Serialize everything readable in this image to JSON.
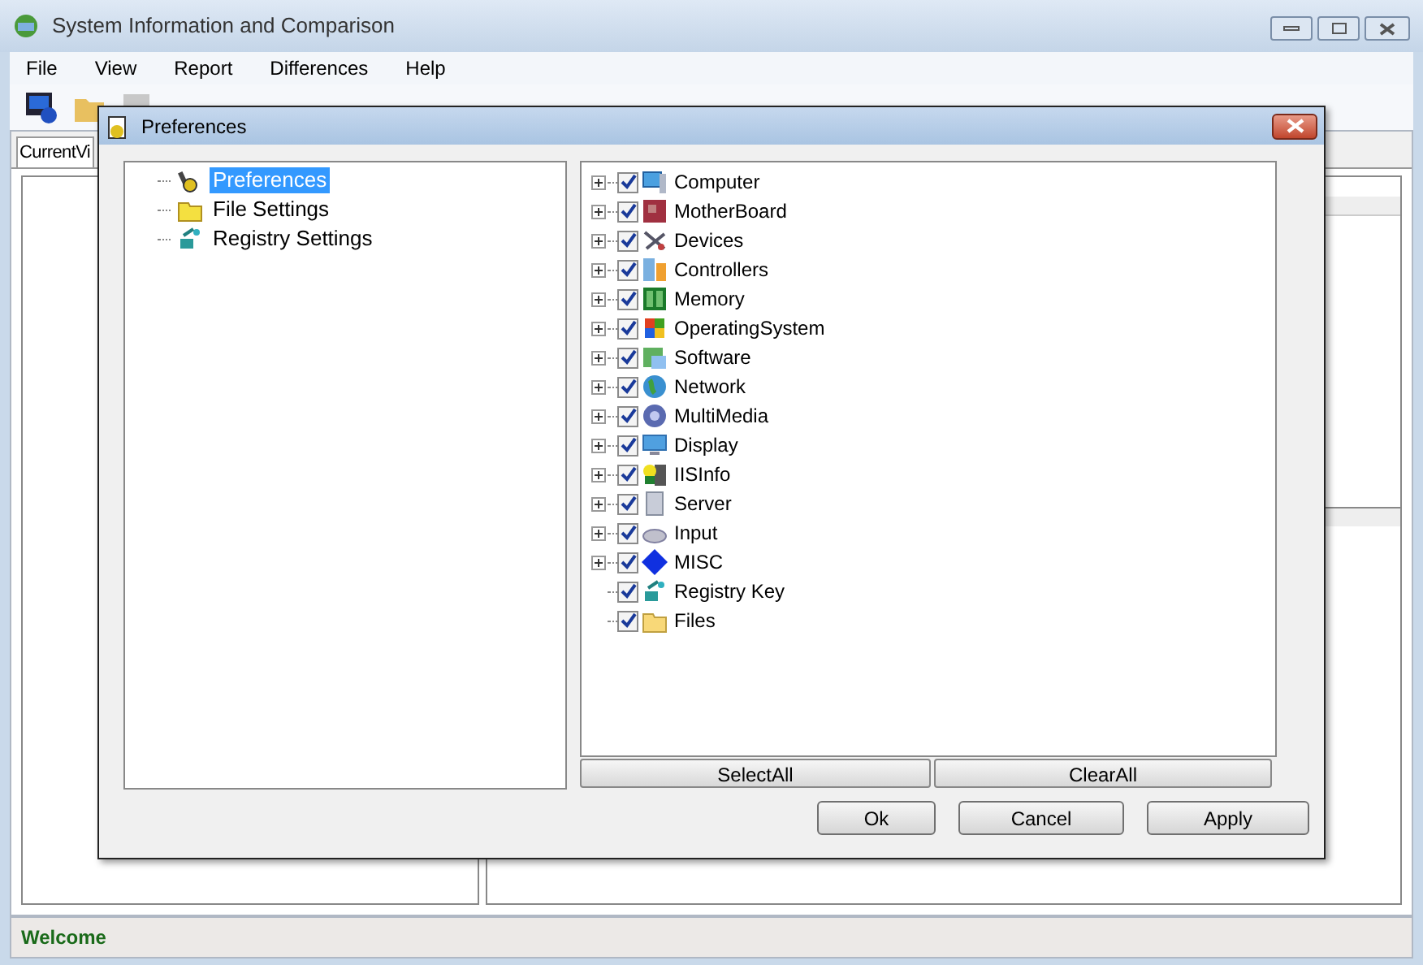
{
  "window": {
    "title": "System Information and Comparison"
  },
  "menu": [
    "File",
    "View",
    "Report",
    "Differences",
    "Help"
  ],
  "main_tab": {
    "label": "CurrentVi",
    "selected": true
  },
  "status_bar": "Welcome",
  "dialog": {
    "title": "Preferences",
    "nav": [
      {
        "label": "Preferences",
        "selected": true
      },
      {
        "label": "File Settings",
        "selected": false
      },
      {
        "label": "Registry Settings",
        "selected": false
      }
    ],
    "categories": [
      {
        "label": "Computer",
        "checked": true,
        "expandable": true
      },
      {
        "label": "MotherBoard",
        "checked": true,
        "expandable": true
      },
      {
        "label": "Devices",
        "checked": true,
        "expandable": true
      },
      {
        "label": "Controllers",
        "checked": true,
        "expandable": true
      },
      {
        "label": "Memory",
        "checked": true,
        "expandable": true
      },
      {
        "label": "OperatingSystem",
        "checked": true,
        "expandable": true
      },
      {
        "label": "Software",
        "checked": true,
        "expandable": true
      },
      {
        "label": "Network",
        "checked": true,
        "expandable": true
      },
      {
        "label": "MultiMedia",
        "checked": true,
        "expandable": true
      },
      {
        "label": "Display",
        "checked": true,
        "expandable": true
      },
      {
        "label": "IISInfo",
        "checked": true,
        "expandable": true
      },
      {
        "label": "Server",
        "checked": true,
        "expandable": true
      },
      {
        "label": "Input",
        "checked": true,
        "expandable": true
      },
      {
        "label": "MISC",
        "checked": true,
        "expandable": true
      },
      {
        "label": "Registry Key",
        "checked": true,
        "expandable": false
      },
      {
        "label": "Files",
        "checked": true,
        "expandable": false
      }
    ],
    "list_buttons": [
      "SelectAll",
      "ClearAll"
    ],
    "buttons": [
      "Ok",
      "Cancel",
      "Apply"
    ]
  }
}
